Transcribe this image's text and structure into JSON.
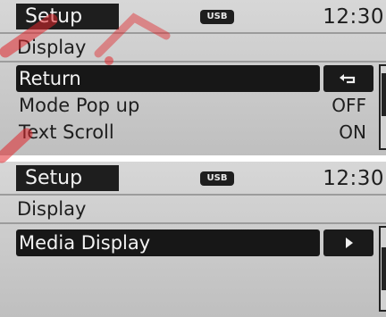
{
  "screens": [
    {
      "tab": "Setup",
      "usb_badge": "USB",
      "clock": "12:30",
      "heading": "Display",
      "rows": [
        {
          "label": "Return",
          "value": "",
          "selected": true,
          "key_icon": "return-arrow-icon"
        },
        {
          "label": "Mode Pop up",
          "value": "OFF",
          "selected": false
        },
        {
          "label": "Text Scroll",
          "value": "ON",
          "selected": false
        }
      ]
    },
    {
      "tab": "Setup",
      "usb_badge": "USB",
      "clock": "12:30",
      "heading": "Display",
      "rows": [
        {
          "label": "Media Display",
          "value": "",
          "selected": true,
          "key_icon": "play-right-icon"
        }
      ]
    }
  ],
  "colors": {
    "screen_bg": "#cacaca",
    "highlight_bg": "#171717",
    "text": "#1e1e1e",
    "watermark_red": "#e0262b"
  }
}
